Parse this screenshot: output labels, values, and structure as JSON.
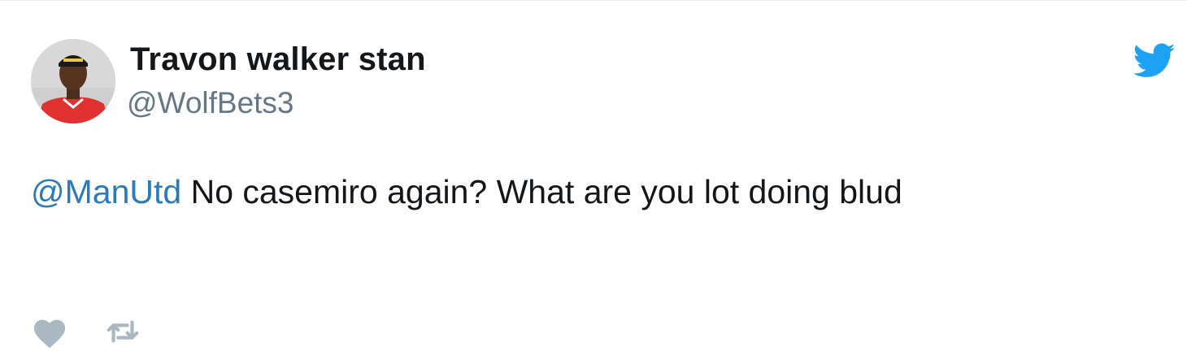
{
  "tweet": {
    "user": {
      "display_name": "Travon walker stan",
      "handle": "@WolfBets3"
    },
    "text": {
      "mention": "@ManUtd",
      "body": " No casemiro again? What are you lot doing blud"
    }
  },
  "icons": {
    "logo": "twitter-bird-icon",
    "like": "heart-icon",
    "retweet": "retweet-icon"
  },
  "colors": {
    "brand": "#1da1f2",
    "mention": "#2b7bb9",
    "text": "#14171a",
    "secondary": "#657786",
    "action_icon": "#aab8c2"
  }
}
